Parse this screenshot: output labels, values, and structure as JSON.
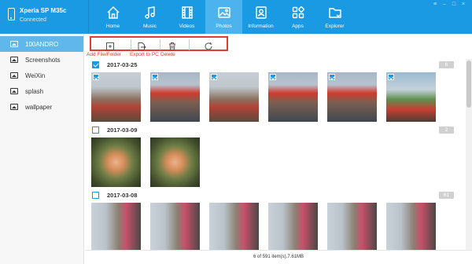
{
  "device": {
    "name": "Xperia SP M35c",
    "status": "Connected"
  },
  "nav": [
    {
      "label": "Home",
      "icon": "home-icon"
    },
    {
      "label": "Music",
      "icon": "music-icon"
    },
    {
      "label": "Videos",
      "icon": "film-icon"
    },
    {
      "label": "Photos",
      "icon": "photo-icon",
      "active": true
    },
    {
      "label": "Information",
      "icon": "contacts-icon"
    },
    {
      "label": "Apps",
      "icon": "apps-icon"
    },
    {
      "label": "Explorer",
      "icon": "folder-icon"
    }
  ],
  "window_controls": [
    "≡",
    "–",
    "□",
    "×"
  ],
  "sidebar": {
    "items": [
      {
        "label": "100ANDRO",
        "active": true
      },
      {
        "label": "Screenshots"
      },
      {
        "label": "WeiXin"
      },
      {
        "label": "splash"
      },
      {
        "label": "wallpaper"
      }
    ]
  },
  "toolbar": {
    "add_label": "Add File/Folder",
    "export_label": "Export to PC",
    "delete_label": "Delete",
    "highlight_color": "#e53935"
  },
  "groups": [
    {
      "date": "2017-03-25",
      "count": "6",
      "checked": true
    },
    {
      "date": "2017-03-09",
      "count": "2",
      "checked": false
    },
    {
      "date": "2017-03-08",
      "count": "61",
      "checked": false
    }
  ],
  "footer": {
    "status": "6 of 591 item(s),7.61MB"
  },
  "colors": {
    "accent": "#1a9ae3",
    "active_tab": "#4db3ee",
    "sidebar_active": "#5fb7ec"
  }
}
